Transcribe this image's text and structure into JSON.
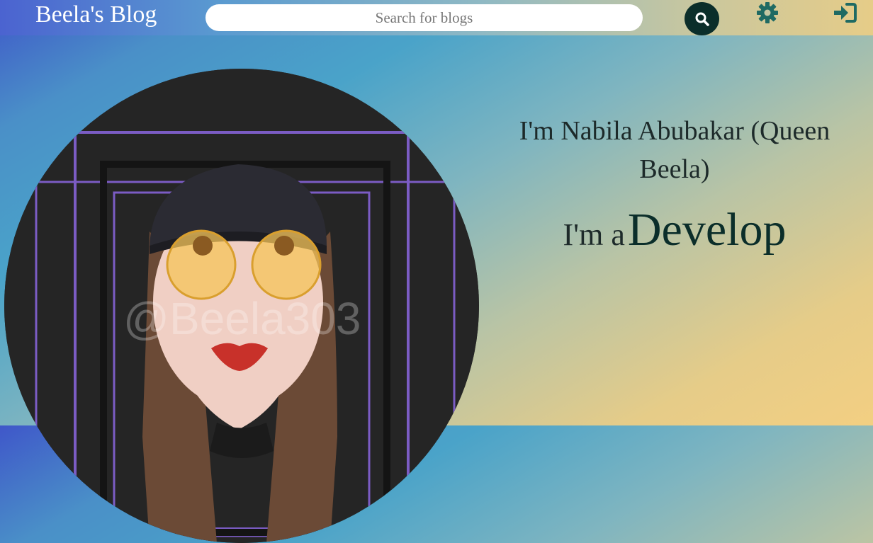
{
  "header": {
    "brand": "Beela's Blog",
    "search_placeholder": "Search for blogs",
    "search_icon": "search-icon",
    "settings_icon": "gear-icon",
    "login_icon": "sign-in-icon"
  },
  "hero": {
    "intro": "I'm Nabila Abubakar (Queen Beela)",
    "role_prefix": "I'm a",
    "role_word": "Develop",
    "avatar_watermark": "@Beela303"
  },
  "colors": {
    "accent": "#0b2e2a",
    "icon": "#1f6a63",
    "gradient_start": "#3f57c9",
    "gradient_end": "#f3cf82"
  }
}
